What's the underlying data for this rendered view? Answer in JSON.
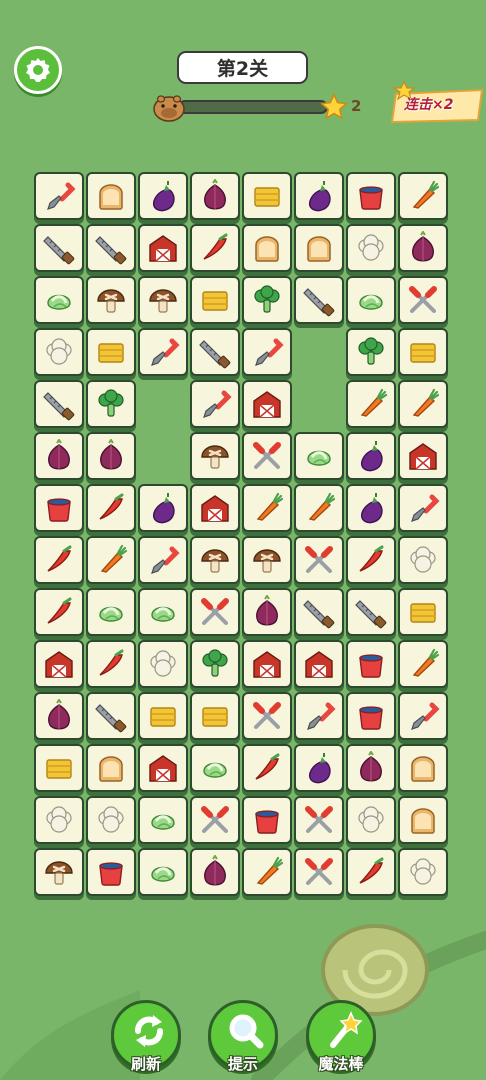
{
  "header": {
    "level_title": "第2关",
    "stars": "2",
    "progress_fraction": 0.0,
    "combo_label": "连击×2"
  },
  "icons": {
    "settings": "gear-icon",
    "player": "capybara-icon",
    "star": "star-icon"
  },
  "board": {
    "rows": [
      [
        "trowel",
        "bread",
        "eggplant",
        "onion",
        "hay",
        "eggplant",
        "pot",
        "carrot"
      ],
      [
        "saw",
        "saw",
        "barn",
        "chili",
        "bread",
        "bread",
        "cauliflower",
        "onion"
      ],
      [
        "cabbage",
        "mushroom",
        "mushroom",
        "hay",
        "broccoli",
        "saw",
        "cabbage",
        "scissors"
      ],
      [
        "cauliflower",
        "hay",
        "trowel",
        "saw",
        "trowel",
        "",
        "broccoli",
        "hay"
      ],
      [
        "saw",
        "broccoli",
        "",
        "trowel",
        "barn",
        "",
        "carrot",
        "carrot"
      ],
      [
        "onion",
        "onion",
        "",
        "mushroom",
        "scissors",
        "cabbage",
        "eggplant",
        "barn"
      ],
      [
        "pot",
        "chili",
        "eggplant",
        "barn",
        "carrot",
        "carrot",
        "eggplant",
        "trowel"
      ],
      [
        "chili",
        "carrot",
        "trowel",
        "mushroom",
        "mushroom",
        "scissors",
        "chili",
        "cauliflower"
      ],
      [
        "chili",
        "cabbage",
        "cabbage",
        "scissors",
        "onion",
        "saw",
        "saw",
        "hay"
      ],
      [
        "barn",
        "chili",
        "cauliflower",
        "broccoli",
        "barn",
        "barn",
        "pot",
        "carrot"
      ],
      [
        "onion",
        "saw",
        "hay",
        "hay",
        "scissors",
        "trowel",
        "pot",
        "trowel"
      ],
      [
        "hay",
        "bread",
        "barn",
        "cabbage",
        "chili",
        "eggplant",
        "onion",
        "bread"
      ],
      [
        "cauliflower",
        "cauliflower",
        "cabbage",
        "scissors",
        "pot",
        "scissors",
        "cauliflower",
        "bread"
      ],
      [
        "mushroom",
        "pot",
        "cabbage",
        "onion",
        "carrot",
        "scissors",
        "chili",
        "cauliflower"
      ]
    ]
  },
  "bottom_bar": {
    "refresh": "刷新",
    "hint": "提示",
    "magic_wand": "魔法棒"
  },
  "colors": {
    "background": "#79b66a",
    "tile_face": "#f7f5dc",
    "tile_border": "#2c4a2e",
    "button_green": "#5ec93a",
    "combo_red": "#b4213d"
  }
}
